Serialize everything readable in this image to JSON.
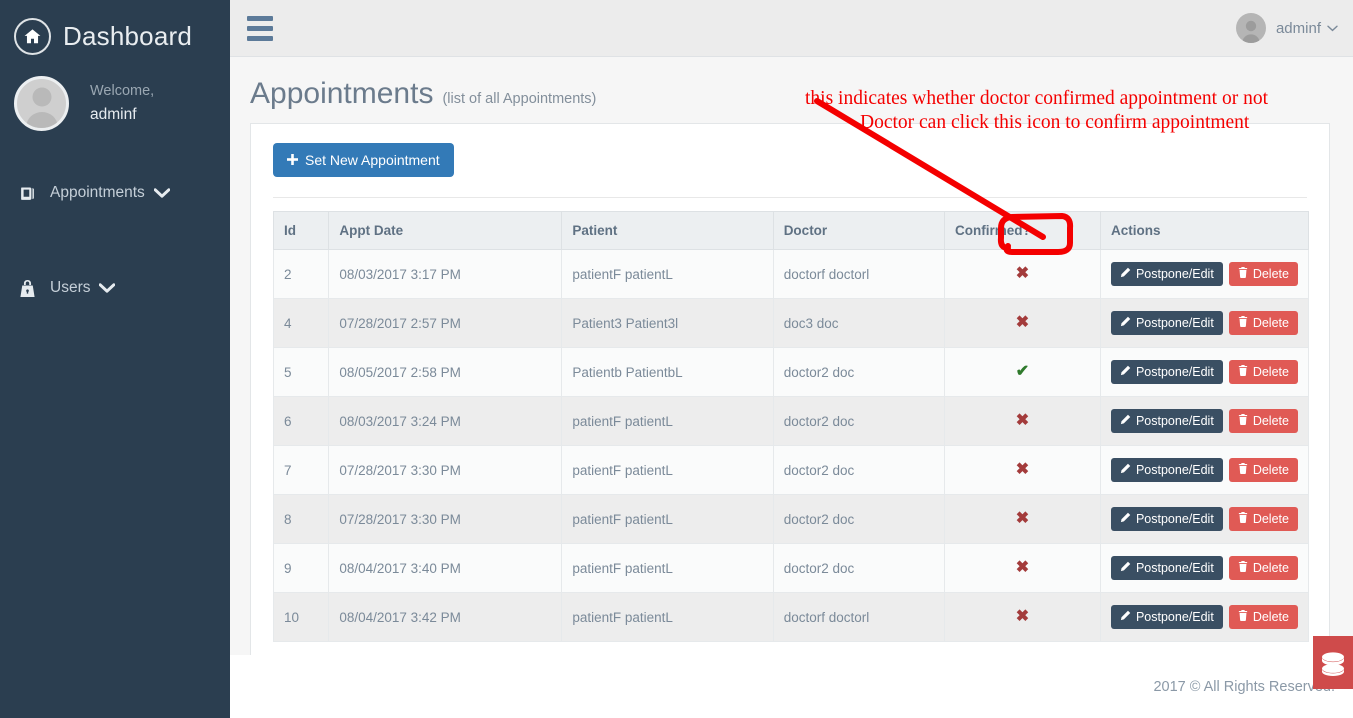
{
  "sidebar": {
    "brand": {
      "label": "Dashboard",
      "icon": "home-icon"
    },
    "profile": {
      "welcome": "Welcome,",
      "username": "adminf",
      "avatar_icon": "user-avatar-icon"
    },
    "items": [
      {
        "label": "Appointments",
        "icon": "book-icon",
        "caret": "chevron-down-icon"
      },
      {
        "label": "Users",
        "icon": "lock-bag-icon",
        "caret": "chevron-down-icon"
      }
    ]
  },
  "topbar": {
    "menu_toggle_icon": "hamburger-icon",
    "user": "adminf",
    "user_caret_icon": "chevron-down-icon",
    "avatar_icon": "user-avatar-icon"
  },
  "page": {
    "title": "Appointments",
    "subtitle": "(list of all Appointments)",
    "new_button": {
      "label": "Set New Appointment",
      "icon": "plus-icon"
    }
  },
  "table": {
    "columns": [
      "Id",
      "Appt Date",
      "Patient",
      "Doctor",
      "Confirmed?",
      "Actions"
    ],
    "row_actions": {
      "edit_label": "Postpone/Edit",
      "edit_icon": "pencil-icon",
      "delete_label": "Delete",
      "delete_icon": "trash-icon"
    },
    "confirmed_glyphs": {
      "yes": "✔",
      "no": "✖"
    },
    "rows": [
      {
        "id": "2",
        "date": "08/03/2017 3:17 PM",
        "patient": "patientF patientL",
        "doctor": "doctorf doctorl",
        "confirmed": false
      },
      {
        "id": "4",
        "date": "07/28/2017 2:57 PM",
        "patient": "Patient3 Patient3l",
        "doctor": "doc3 doc",
        "confirmed": false
      },
      {
        "id": "5",
        "date": "08/05/2017 2:58 PM",
        "patient": "Patientb PatientbL",
        "doctor": "doctor2 doc",
        "confirmed": true
      },
      {
        "id": "6",
        "date": "08/03/2017 3:24 PM",
        "patient": "patientF patientL",
        "doctor": "doctor2 doc",
        "confirmed": false
      },
      {
        "id": "7",
        "date": "07/28/2017 3:30 PM",
        "patient": "patientF patientL",
        "doctor": "doctor2 doc",
        "confirmed": false
      },
      {
        "id": "8",
        "date": "07/28/2017 3:30 PM",
        "patient": "patientF patientL",
        "doctor": "doctor2 doc",
        "confirmed": false
      },
      {
        "id": "9",
        "date": "08/04/2017 3:40 PM",
        "patient": "patientF patientL",
        "doctor": "doctor2 doc",
        "confirmed": false
      },
      {
        "id": "10",
        "date": "08/04/2017 3:42 PM",
        "patient": "patientF patientL",
        "doctor": "doctorf doctorl",
        "confirmed": false
      }
    ]
  },
  "footer": {
    "copyright": "2017 © All Rights Reserved.",
    "corner_badge_icon": "database-stack-icon"
  },
  "annotation": {
    "line1": "this indicates whether doctor confirmed appointment or not",
    "line2": "Doctor can click this icon to confirm appointment",
    "color": "#f40000"
  },
  "colors": {
    "sidebar_bg": "#2b3e50",
    "primary_button": "#337ab7",
    "edit_button": "#3a4f63",
    "delete_button": "#e05a55",
    "confirmed_yes": "#2f7a2c",
    "confirmed_no": "#a33b3b",
    "badge_red": "#cf4b4b"
  }
}
